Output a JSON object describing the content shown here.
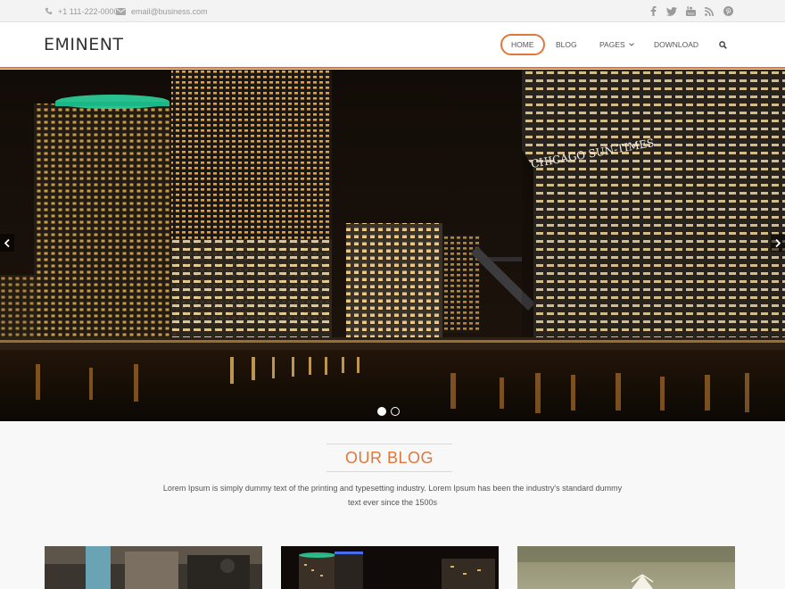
{
  "topbar": {
    "phone": "+1 111-222-0000",
    "email": "email@business.com",
    "socials": [
      "facebook-icon",
      "twitter-icon",
      "youtube-icon",
      "rss-icon",
      "pinterest-icon"
    ]
  },
  "header": {
    "logo": "EMINENT",
    "nav": {
      "home": "HOME",
      "blog": "BLOG",
      "pages": "PAGES",
      "download": "DOWNLOAD"
    },
    "accent": "#e0773a"
  },
  "slider": {
    "building_sign": "CHICAGO SUN-TIMES",
    "slide_count": 2,
    "active_slide": 1
  },
  "blog": {
    "title": "OUR BLOG",
    "description": "Lorem Ipsum is simply dummy text of the printing and typesetting industry. Lorem Ipsum has been the industry's standard dummy text ever since the 1500s"
  }
}
